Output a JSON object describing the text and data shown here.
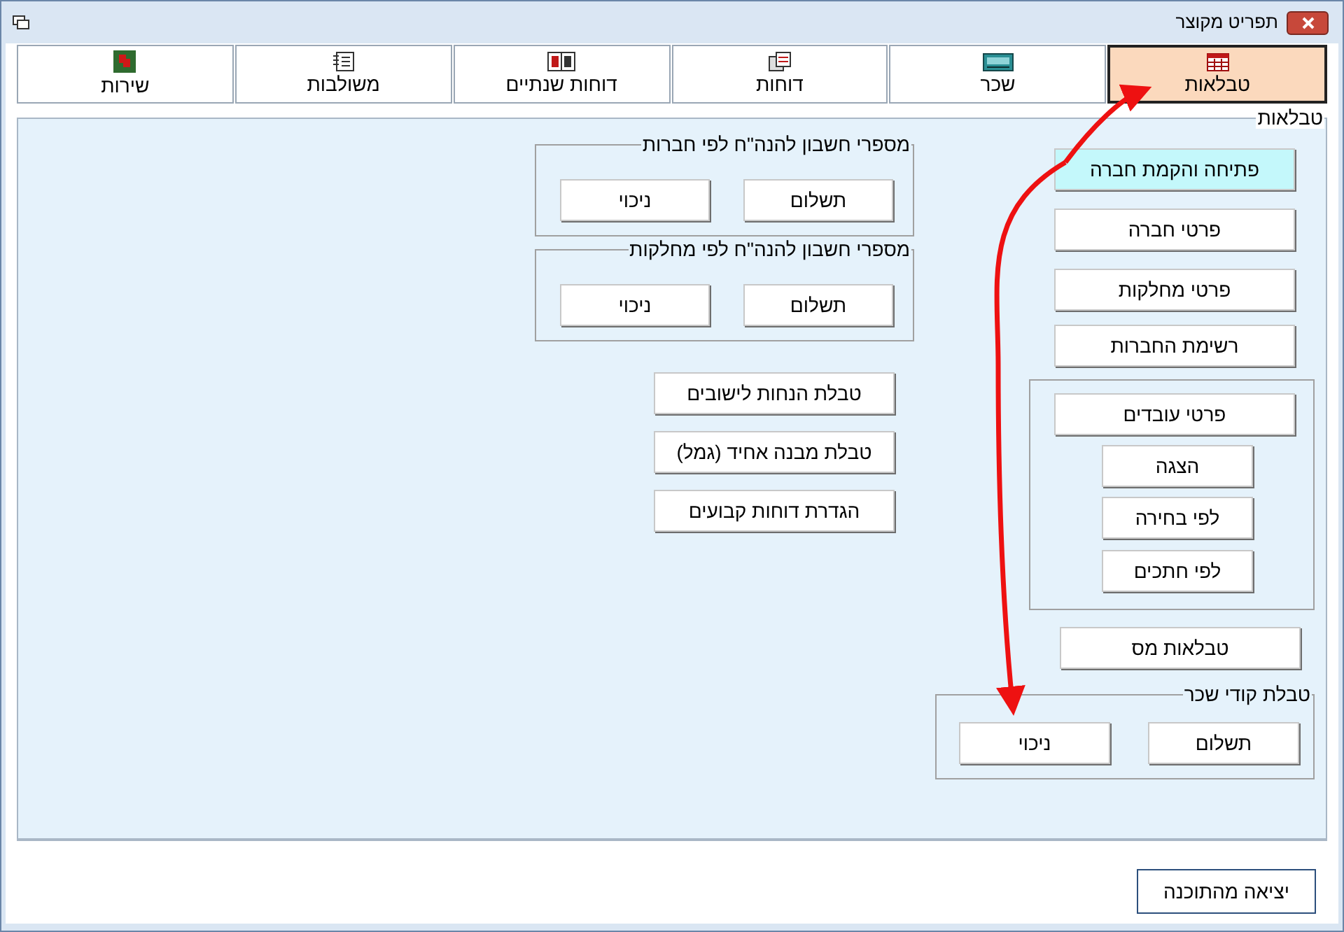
{
  "window": {
    "title": "תפריט מקוצר"
  },
  "tabs": [
    {
      "label": "טבלאות",
      "selected": true
    },
    {
      "label": "שכר",
      "selected": false
    },
    {
      "label": "דוחות",
      "selected": false
    },
    {
      "label": "דוחות שנתיים",
      "selected": false
    },
    {
      "label": "משולבות",
      "selected": false
    },
    {
      "label": "שירות",
      "selected": false
    }
  ],
  "panel": {
    "title": "טבלאות"
  },
  "company_buttons": [
    {
      "label": "פתיחה והקמת חברה",
      "highlighted": true
    },
    {
      "label": "פרטי חברה",
      "highlighted": false
    },
    {
      "label": "פרטי מחלקות",
      "highlighted": false
    },
    {
      "label": "רשימת החברות",
      "highlighted": false
    }
  ],
  "employees_group": {
    "button": "פרטי עובדים",
    "sub_buttons": [
      "הצגה",
      "לפי בחירה",
      "לפי חתכים"
    ]
  },
  "tax_button": "טבלאות מס",
  "pay_codes_group": {
    "title": "טבלת קודי שכר",
    "buttons": [
      "תשלום",
      "ניכוי"
    ]
  },
  "account_groups": [
    {
      "title": "מספרי חשבון להנה\"ח לפי חברות",
      "buttons": [
        "תשלום",
        "ניכוי"
      ]
    },
    {
      "title": "מספרי חשבון להנה\"ח לפי מחלקות",
      "buttons": [
        "תשלום",
        "ניכוי"
      ]
    }
  ],
  "table_buttons": [
    "טבלת הנחות לישובים",
    "טבלת מבנה אחיד (גמל)",
    "הגדרת דוחות קבועים"
  ],
  "exit_button": "יציאה מהתוכנה"
}
